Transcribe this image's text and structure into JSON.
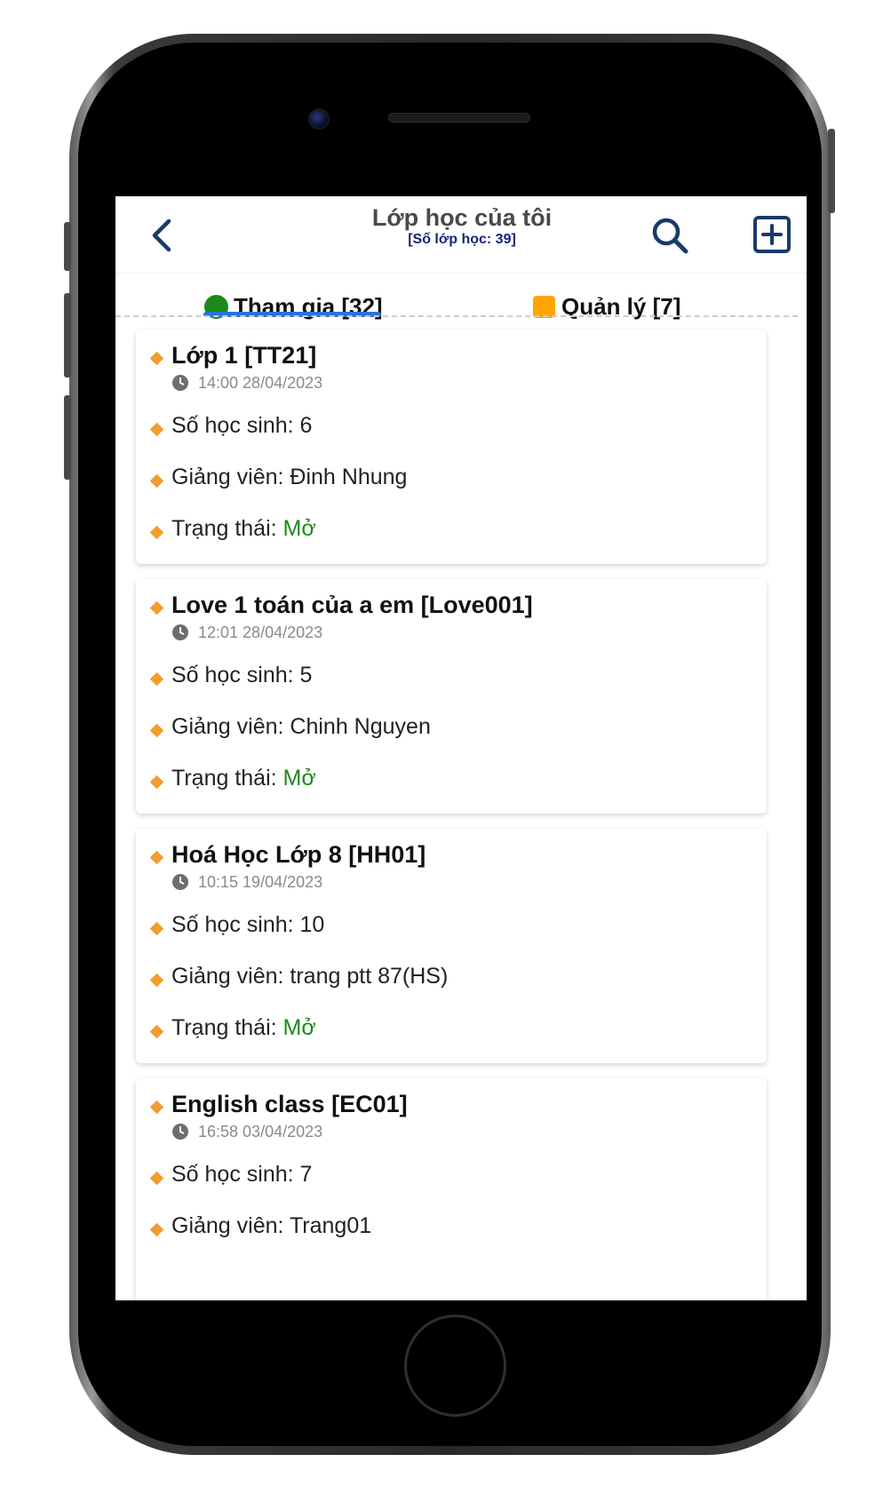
{
  "header": {
    "title": "Lớp học của tôi",
    "subtitle": "[Số lớp học: 39]"
  },
  "tabs": [
    {
      "label": "Tham gia [32]",
      "color": "#1b8a1b",
      "active": true
    },
    {
      "label": "Quản lý [7]",
      "color": "#ffa500",
      "active": false
    }
  ],
  "classes": [
    {
      "title": "Lớp 1 [TT21]",
      "time": "14:00 28/04/2023",
      "students": " Số học sinh: 6",
      "teacher": "Giảng viên: Đinh Nhung",
      "status_label": "Trạng thái: ",
      "status_value": "Mở"
    },
    {
      "title": "Love 1 toán của a em [Love001]",
      "time": "12:01 28/04/2023",
      "students": " Số học sinh: 5",
      "teacher": "Giảng viên: Chinh Nguyen",
      "status_label": "Trạng thái: ",
      "status_value": "Mở"
    },
    {
      "title": "Hoá Học Lớp 8 [HH01]",
      "time": "10:15 19/04/2023",
      "students": " Số học sinh: 10",
      "teacher": "Giảng viên: trang ptt 87(HS)",
      "status_label": "Trạng thái: ",
      "status_value": "Mở"
    },
    {
      "title": "English class [EC01]",
      "time": "16:58 03/04/2023",
      "students": " Số học sinh: 7",
      "teacher": "Giảng viên: Trang01",
      "status_label": "",
      "status_value": ""
    }
  ],
  "colors": {
    "accent": "#2a73d9",
    "bullet": "#f39c2f",
    "open_status": "#1b8a1b",
    "title_dark_blue": "#1a237e"
  },
  "icons": [
    "back-arrow-icon",
    "search-icon",
    "add-square-icon",
    "clock-icon",
    "diamond-bullet-icon"
  ]
}
